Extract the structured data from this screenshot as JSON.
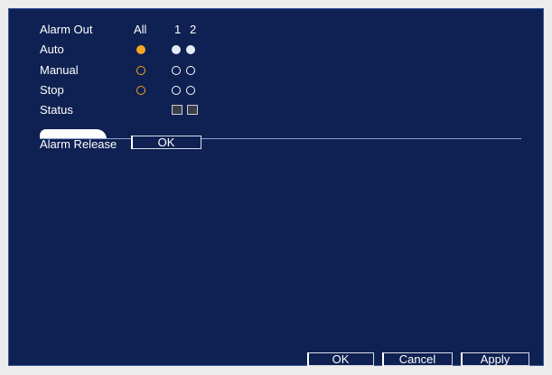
{
  "header": {
    "alarm_out_label": "Alarm Out",
    "all_label": "All",
    "channels": [
      "1",
      "2"
    ]
  },
  "rows": {
    "auto_label": "Auto",
    "manual_label": "Manual",
    "stop_label": "Stop",
    "status_label": "Status"
  },
  "alarm_release": {
    "label": "Alarm Release",
    "button_label": "OK"
  },
  "footer": {
    "ok_label": "OK",
    "cancel_label": "Cancel",
    "apply_label": "Apply"
  },
  "colors": {
    "panel_bg": "#0f2152",
    "selected_all": "#f5a623",
    "selected_channel": "#e6eaf5"
  }
}
